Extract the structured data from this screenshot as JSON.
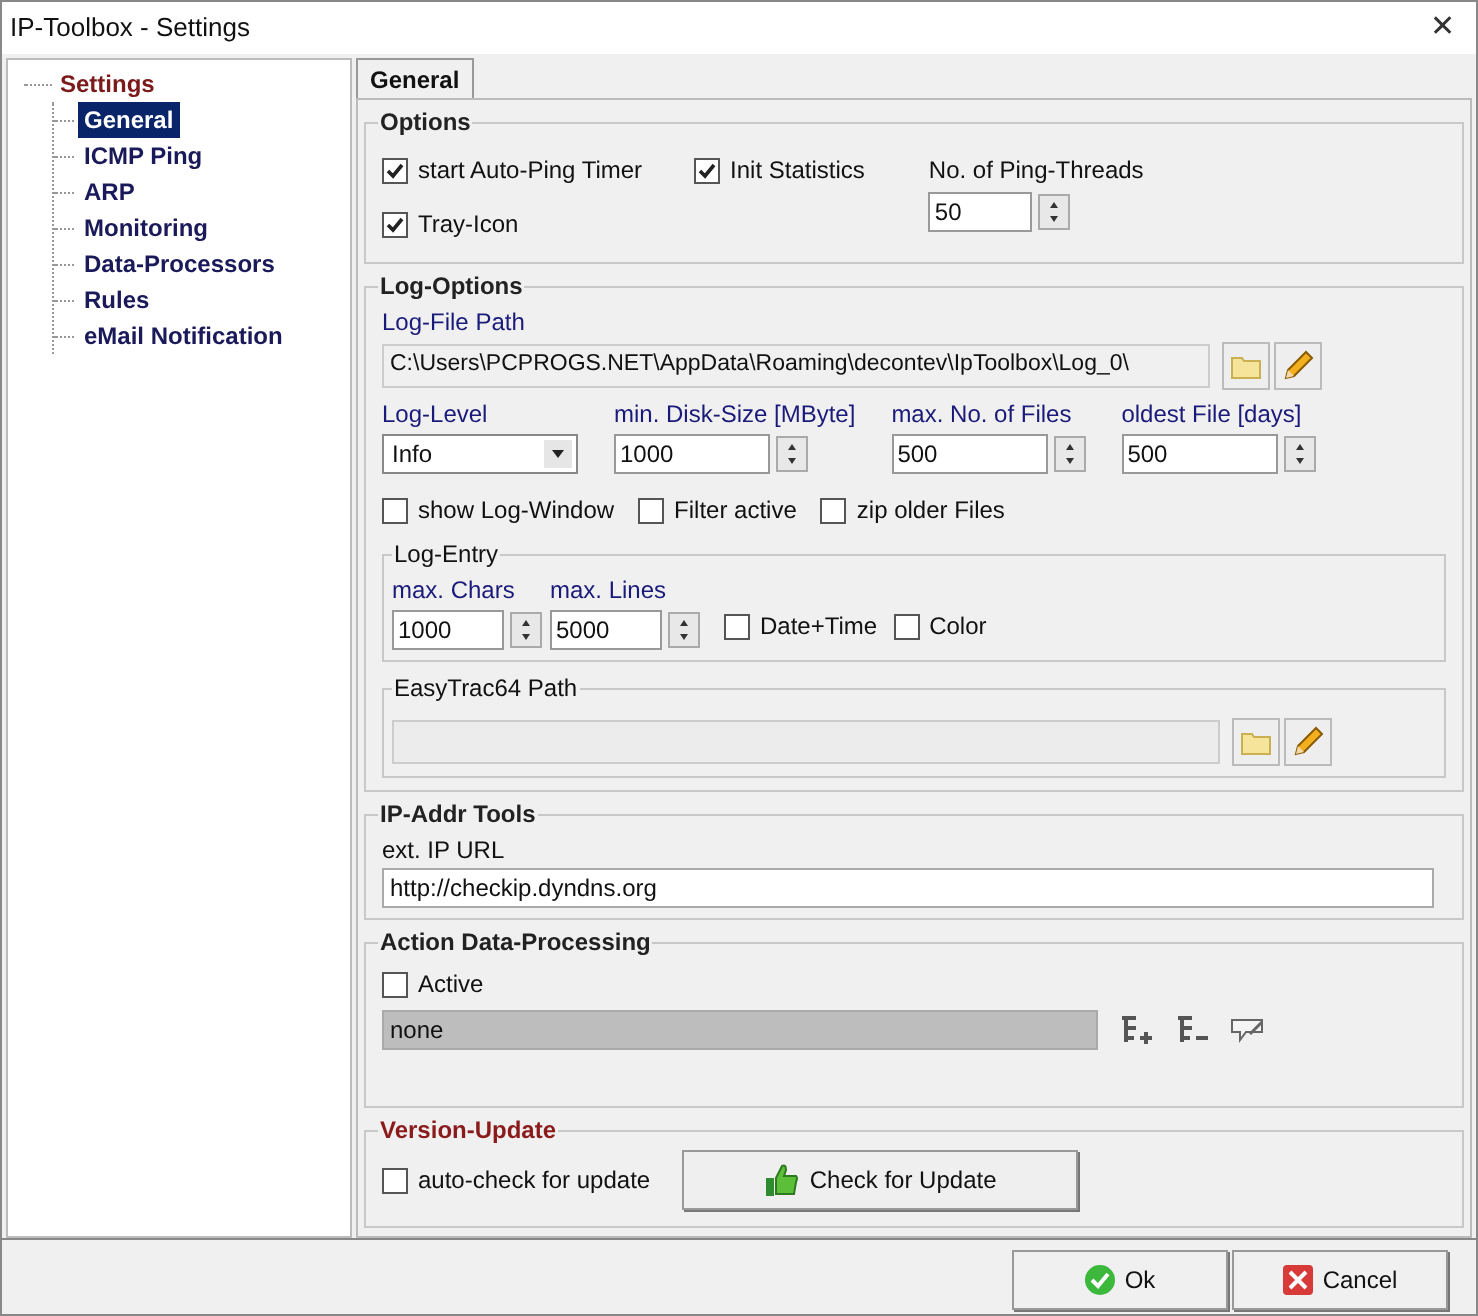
{
  "window": {
    "title": "IP-Toolbox - Settings",
    "close": "✕"
  },
  "tree": {
    "label": "Settings",
    "children": [
      {
        "label": "General",
        "selected": true
      },
      {
        "label": "ICMP Ping",
        "selected": false
      },
      {
        "label": "ARP",
        "selected": false
      },
      {
        "label": "Monitoring",
        "selected": false
      },
      {
        "label": "Data-Processors",
        "selected": false
      },
      {
        "label": "Rules",
        "selected": false
      },
      {
        "label": "eMail Notification",
        "selected": false
      }
    ]
  },
  "tabs": [
    {
      "label": "General",
      "selected": true
    }
  ],
  "options": {
    "title": "Options",
    "checkboxes": [
      {
        "label": "start Auto-Ping Timer",
        "checked": true
      },
      {
        "label": "Init Statistics",
        "checked": true
      },
      {
        "label": "Tray-Icon",
        "checked": true
      }
    ],
    "threads": {
      "label": "No. of Ping-Threads",
      "value": "50"
    }
  },
  "log_options": {
    "title": "Log-Options",
    "file_path": {
      "label": "Log-File Path",
      "value": "C:\\Users\\PCPROGS.NET\\AppData\\Roaming\\decontev\\IpToolbox\\Log_0\\"
    },
    "level": {
      "label": "Log-Level",
      "value": "Info"
    },
    "spins": [
      {
        "label": "min. Disk-Size [MByte]",
        "value": "1000"
      },
      {
        "label": "max. No. of Files",
        "value": "500"
      },
      {
        "label": "oldest File [days]",
        "value": "500"
      }
    ],
    "checkboxes": [
      {
        "label": "show Log-Window",
        "checked": false
      },
      {
        "label": "Filter active",
        "checked": false
      },
      {
        "label": "zip older Files",
        "checked": false
      }
    ],
    "log_entry": {
      "title": "Log-Entry",
      "spins": [
        {
          "label": "max. Chars",
          "value": "1000"
        },
        {
          "label": "max. Lines",
          "value": "5000"
        }
      ],
      "checkboxes": [
        {
          "label": "Date+Time",
          "checked": false
        },
        {
          "label": "Color",
          "checked": false
        }
      ]
    },
    "easytrac": {
      "title": "EasyTrac64 Path"
    }
  },
  "ip_tools": {
    "title": "IP-Addr Tools",
    "ext_ip": {
      "label": "ext. IP URL",
      "value": "http://checkip.dyndns.org"
    }
  },
  "action": {
    "title": "Action Data-Processing",
    "active": {
      "label": "Active",
      "checked": false
    },
    "value": "none"
  },
  "version": {
    "title": "Version-Update",
    "auto_check": {
      "label": "auto-check for update",
      "checked": false
    },
    "button": "Check for Update"
  },
  "buttons": [
    {
      "label": "Ok",
      "kind": "ok"
    },
    {
      "label": "Cancel",
      "kind": "cancel"
    }
  ]
}
